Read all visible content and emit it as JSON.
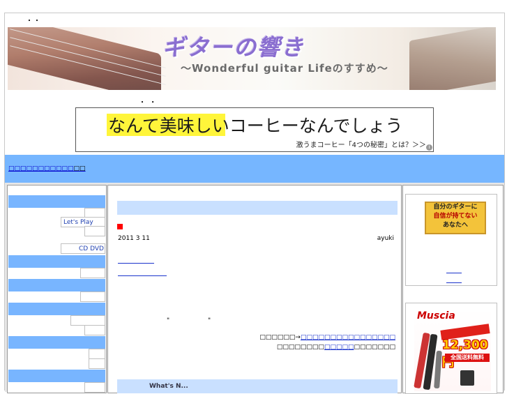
{
  "header": {
    "dots_top": "・・",
    "dots_mid": "・ ・",
    "banner_title": "ギターの響き",
    "banner_subtitle": "～Wonderful guitar Lifeのすすめ～"
  },
  "ad_banner": {
    "headline": "なんて美味しいコーヒーなんでしょう",
    "subline": "激うまコーヒー「4つの秘密」とは？＞＞",
    "info_icon": "info-icon"
  },
  "navbar": {
    "breadcrumb_link": "□□□□□□□□□□□",
    "breadcrumb_tail": "□□"
  },
  "left_sidebar": {
    "item_lets_play": "Let's Play",
    "item_cd_dvd": "CD DVD"
  },
  "article": {
    "marker": "■",
    "date": "2011 3 11",
    "author": "ayuki",
    "quote_marks": "\"  \"",
    "arrow_prefix": "□□□□□□→",
    "arrow_link": "□□□□□□□□□□□□□□□□",
    "ref_prefix": "□□□□□□□□",
    "ref_link": "□□□□□",
    "ref_suffix": "□□□□□□□",
    "footer_text": "What's N..."
  },
  "right_sidebar": {
    "ad1_line1": "自分のギターに",
    "ad1_line2": "自信が持てない",
    "ad1_line3": "あなたへ",
    "ad2_brand": "Muscia",
    "ad2_price": "12,300円",
    "ad2_free": "全国送料無料"
  },
  "colors": {
    "nav_blue": "#76b6ff",
    "header_lightblue": "#c9e0ff",
    "link_blue": "#1a33cc"
  }
}
